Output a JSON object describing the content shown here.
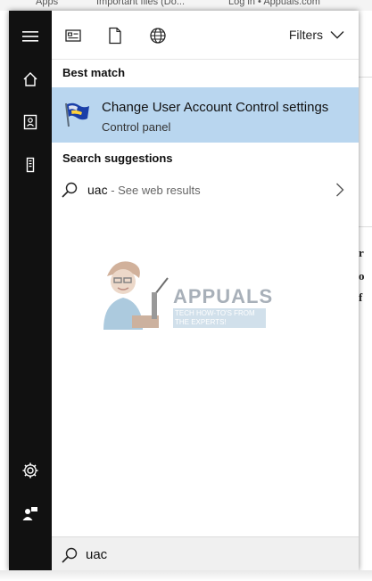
{
  "background": {
    "top_items": [
      "Apps",
      "Important files (Do...",
      "Log in • Appuals.com"
    ]
  },
  "rail": {
    "items": [
      {
        "icon": "hamburger-menu-icon"
      },
      {
        "icon": "home-icon"
      },
      {
        "icon": "notebook-icon"
      },
      {
        "icon": "device-icon"
      },
      {
        "icon": "settings-gear-icon"
      },
      {
        "icon": "feedback-icon"
      }
    ]
  },
  "topbar": {
    "tabs": [
      {
        "icon": "apps-icon"
      },
      {
        "icon": "documents-icon"
      },
      {
        "icon": "web-globe-icon"
      }
    ],
    "filters_label": "Filters"
  },
  "best_match": {
    "heading": "Best match",
    "title": "Change User Account Control settings",
    "subtitle": "Control panel",
    "icon": "uac-flag-icon"
  },
  "suggestions": {
    "heading": "Search suggestions",
    "items": [
      {
        "query": "uac",
        "suffix": " - See web results"
      }
    ]
  },
  "watermark": {
    "brand": "APPUALS",
    "tagline": "TECH HOW-TO'S FROM THE EXPERTS!"
  },
  "search": {
    "value": "uac",
    "placeholder": ""
  },
  "colors": {
    "rail_bg": "#111111",
    "selection_bg": "#b9d6ef",
    "searchbox_bg": "#f0f0f0"
  }
}
